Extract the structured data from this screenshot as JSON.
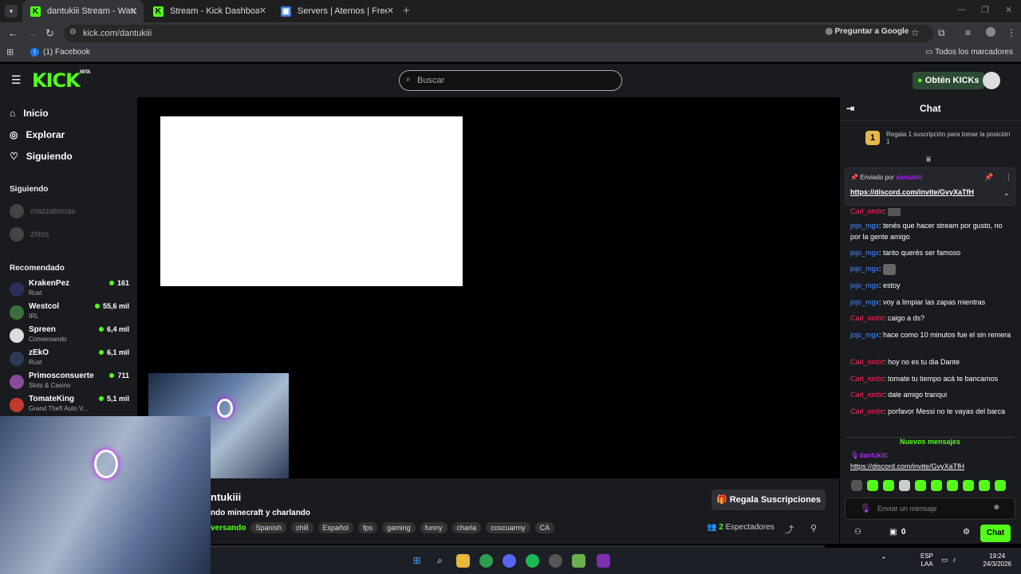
{
  "browser": {
    "tabs": [
      {
        "title": "dantukiii Stream - Watch Live o",
        "favicon": "kick-icon",
        "color": "#53fc18"
      },
      {
        "title": "Stream - Kick Dashboard",
        "favicon": "kick-icon",
        "color": "#53fc18"
      },
      {
        "title": "Servers | Aternos | Free Minecra",
        "favicon": "aternos-icon",
        "color": "#3a7bd5"
      }
    ],
    "url": "kick.com/dantukiii",
    "google_btn": "Preguntar a Google",
    "bookmark": "(1) Facebook",
    "all_bookmarks": "Todos los marcadores"
  },
  "header": {
    "logo": "KICK",
    "logo_beta": "BETA",
    "search_placeholder": "Buscar",
    "kicks_btn": "Obtén KICKs"
  },
  "sidebar": {
    "nav": [
      "Inicio",
      "Explorar",
      "Siguiendo"
    ],
    "following_title": "Siguiendo",
    "following": [
      "mazzatomas",
      "zhtss"
    ],
    "recommended_title": "Recomendado",
    "recommended": [
      {
        "name": "KrakenPez",
        "cat": "Rust",
        "viewers": "161"
      },
      {
        "name": "Westcol",
        "cat": "IRL",
        "viewers": "55,6 mil"
      },
      {
        "name": "Spreen",
        "cat": "Conversando",
        "viewers": "6,4 mil"
      },
      {
        "name": "zEkO",
        "cat": "Rust",
        "viewers": "6,1 mil"
      },
      {
        "name": "Primosconsuerte",
        "cat": "Slots & Casino",
        "viewers": "711"
      },
      {
        "name": "TomateKing",
        "cat": "Grand Theft Auto V...",
        "viewers": "5,1 mil"
      }
    ]
  },
  "stream": {
    "name": "ntukiii",
    "title": "ndo minecraft y charlando",
    "category": "versando",
    "tags": [
      "Spanish",
      "chill",
      "Español",
      "fps",
      "gaming",
      "funny",
      "charla",
      "coscuarmy",
      "CA"
    ],
    "sub_btn": "Regala Suscripciones",
    "viewers_count": "2",
    "viewers_label": "Espectadores"
  },
  "chat": {
    "title": "Chat",
    "gift_badge": "1",
    "gift_text": "Regala 1 suscripción para tomar la posición 1",
    "pinned_by": "Enviado por",
    "pinned_user": "dantukiii",
    "pinned_link": "https://discord.com/invite/GvyXaTfH",
    "messages": [
      {
        "user": "Carl_nmbr",
        "text": ":",
        "type": "u2"
      },
      {
        "user": "jojo_mgx",
        "text": ": tenés que hacer stream por gusto, no por la gente amigo",
        "type": "u1"
      },
      {
        "user": "jojo_mgx",
        "text": ": tanto querés ser famoso",
        "type": "u1"
      },
      {
        "user": "jojo_mgx",
        "text": ":",
        "type": "u1"
      },
      {
        "user": "jojo_mgx",
        "text": ": estoy",
        "type": "u1"
      },
      {
        "user": "jojo_mgx",
        "text": ": voy a limpiar las zapas mientras",
        "type": "u1"
      },
      {
        "user": "Carl_nmbr",
        "text": ": caigo a ds?",
        "type": "u2"
      },
      {
        "user": "jojo_mgx",
        "text": ": hace como 10 minutos fue el sin remera",
        "type": "u1"
      },
      {
        "user": "Carl_nmbr",
        "text": ": hoy no es tu dia Dante",
        "type": "u2"
      },
      {
        "user": "Carl_nmbr",
        "text": ": tomate tu tiempo acá te bancamos",
        "type": "u2"
      },
      {
        "user": "Carl_nmbr",
        "text": ": dale amigo tranqui",
        "type": "u2"
      },
      {
        "user": "Carl_nmbr",
        "text": ": porfavor Messi no te vayas del barca",
        "type": "u2"
      }
    ],
    "new_messages": "Nuevos mensajes",
    "last_user": "dantukiii",
    "last_link": "https://discord.com/invite/GvyXaTfH",
    "input_placeholder": "Enviar un mensaje",
    "send_btn": "Chat",
    "points": "0"
  },
  "taskbar": {
    "lang1": "ESP",
    "lang2": "LAA",
    "time": "19:24",
    "date": "24/3/2026"
  }
}
